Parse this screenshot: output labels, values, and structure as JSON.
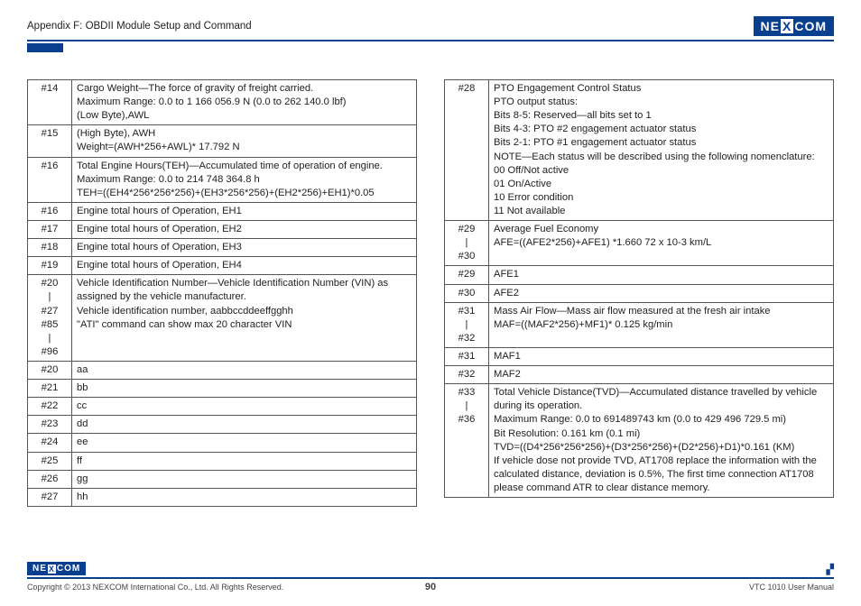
{
  "header": {
    "title": "Appendix F: OBDII Module Setup and Command",
    "brandA": "NE",
    "brandB": "COM"
  },
  "left": [
    {
      "i": "#14",
      "t": "Cargo Weight—The force of gravity of freight carried.\nMaximum Range: 0.0 to 1 166 056.9 N (0.0 to 262 140.0 lbf)\n(Low Byte),AWL"
    },
    {
      "i": "#15",
      "t": "(High Byte), AWH\nWeight=(AWH*256+AWL)* 17.792 N"
    },
    {
      "i": "#16",
      "t": "Total Engine Hours(TEH)—Accumulated time of operation of engine.\nMaximum Range: 0.0 to 214 748 364.8 h\nTEH=((EH4*256*256*256)+(EH3*256*256)+(EH2*256)+EH1)*0.05"
    },
    {
      "i": "#16",
      "t": "Engine total hours of Operation, EH1"
    },
    {
      "i": "#17",
      "t": "Engine total hours of Operation, EH2"
    },
    {
      "i": "#18",
      "t": "Engine total hours of Operation, EH3"
    },
    {
      "i": "#19",
      "t": "Engine total hours of Operation, EH4"
    },
    {
      "i": "#20\n|\n#27\n#85\n|\n#96",
      "t": "Vehicle Identification Number—Vehicle Identification Number (VIN) as assigned by the vehicle manufacturer.\nVehicle identification number, aabbccddeeffgghh\n\"ATI\" command can show max 20 character VIN"
    },
    {
      "i": "#20",
      "t": "aa"
    },
    {
      "i": "#21",
      "t": "bb"
    },
    {
      "i": "#22",
      "t": "cc"
    },
    {
      "i": "#23",
      "t": "dd"
    },
    {
      "i": "#24",
      "t": "ee"
    },
    {
      "i": "#25",
      "t": "ff"
    },
    {
      "i": "#26",
      "t": "gg"
    },
    {
      "i": "#27",
      "t": "hh"
    }
  ],
  "right": [
    {
      "i": "#28",
      "t": "PTO Engagement Control Status\nPTO output status:\nBits 8-5: Reserved—all bits set to 1\nBits 4-3: PTO #2 engagement actuator status\nBits 2-1: PTO #1 engagement actuator status\nNOTE—Each status will be described using the following nomenclature:\n00 Off/Not active\n01 On/Active\n10 Error condition\n11 Not available"
    },
    {
      "i": "#29\n|\n#30",
      "t": "Average Fuel Economy\nAFE=((AFE2*256)+AFE1) *1.660 72 x 10-3 km/L"
    },
    {
      "i": "#29",
      "t": "AFE1"
    },
    {
      "i": "#30",
      "t": "AFE2"
    },
    {
      "i": "#31\n|\n#32",
      "t": "Mass Air Flow—Mass air flow measured at the fresh air intake\nMAF=((MAF2*256)+MF1)* 0.125 kg/min"
    },
    {
      "i": "#31",
      "t": "MAF1"
    },
    {
      "i": "#32",
      "t": "MAF2"
    },
    {
      "i": "#33\n|\n#36",
      "t": "Total Vehicle Distance(TVD)—Accumulated distance travelled by vehicle during its operation.\nMaximum Range: 0.0 to 691489743 km (0.0 to 429 496 729.5 mi)\nBit Resolution: 0.161 km (0.1 mi)\nTVD=((D4*256*256*256)+(D3*256*256)+(D2*256)+D1)*0.161 (KM)\nIf vehicle dose not provide TVD, AT1708 replace the information with the calculated distance, deviation is 0.5%, The first time connection AT1708 please command ATR to clear distance memory."
    }
  ],
  "footer": {
    "copy": "Copyright © 2013 NEXCOM International Co., Ltd. All Rights Reserved.",
    "page": "90",
    "manual": "VTC 1010 User Manual"
  }
}
